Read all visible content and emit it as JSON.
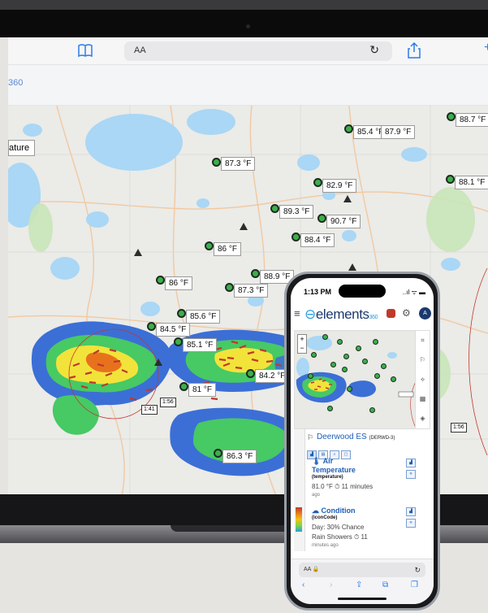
{
  "laptop": {
    "url_bar": {
      "reader_label": "AA",
      "reload_icon": "reload-icon"
    },
    "brand_fragment": "360",
    "partial_label": "ature",
    "time_badges": [
      "1:41",
      "1:56",
      "1:56"
    ],
    "temperature_labels": [
      "88.7 °F",
      "85.4 °F",
      "87.9 °F",
      "87.3 °F",
      "88.1 °F",
      "82.9 °F",
      "89.3 °F",
      "90.7 °F",
      "88.4 °F",
      "86 °F",
      "88.9 °F",
      "86 °F",
      "87.3 °F",
      "85.6 °F",
      "84.5 °F",
      "85.1 °F",
      "84.2 °F",
      "81 °F",
      "86.3 °F"
    ]
  },
  "phone": {
    "status_time": "1:13 PM",
    "status_icons": "..ıl ᯤ ▬",
    "logo": "elements",
    "logo_suffix": "360",
    "avatar": "A",
    "site_name": "Deerwood ES",
    "site_code": "(DERWD-3)",
    "air_title": "Air",
    "air_title2": "Temperature",
    "air_sub": "(temperature)",
    "air_value": "81.0 °F",
    "air_when": "11 minutes",
    "air_ago": "ago",
    "cond_title": "Condition",
    "cond_sub": "(iconCode)",
    "cond_value1": "Day: 30% Chance",
    "cond_value2": "Rain Showers",
    "cond_when": "11",
    "cond_ago": "minutes ago",
    "url_reader": "AA",
    "url_lock": "🔒"
  },
  "colors": {
    "accent": "#2a9de0",
    "brand": "#1b3a6e",
    "station": "#3bb04a"
  }
}
